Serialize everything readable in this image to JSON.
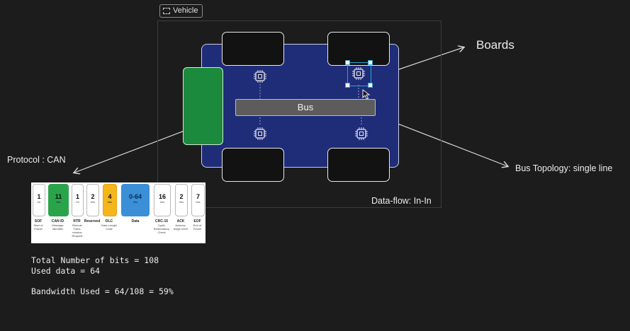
{
  "frame": {
    "label": "Vehicle"
  },
  "vehicle": {
    "bus_label": "Bus"
  },
  "annotations": {
    "boards": "Boards",
    "protocol": "Protocol : CAN",
    "bus_topology": "Bus Topology: single line",
    "data_flow": "Data-flow: In-In"
  },
  "can_frame": {
    "fields": [
      {
        "bits": "1",
        "unit": "bit",
        "name": "SOF",
        "desc": "Start of Frame",
        "color": "#ffffff"
      },
      {
        "bits": "11",
        "unit": "bits",
        "name": "CAN ID",
        "desc": "Message Identifier",
        "color": "#2aa44a"
      },
      {
        "bits": "1",
        "unit": "bit",
        "name": "RTR",
        "desc": "Remote Trans-mission Request",
        "color": "#ffffff"
      },
      {
        "bits": "2",
        "unit": "bits",
        "name": "Reserved",
        "desc": "",
        "color": "#ffffff"
      },
      {
        "bits": "4",
        "unit": "bits",
        "name": "DLC",
        "desc": "Data Length Code",
        "color": "#f5b51c"
      },
      {
        "bits": "0-64",
        "unit": "bits",
        "name": "Data",
        "desc": "",
        "color": "#3a8fd7"
      },
      {
        "bits": "16",
        "unit": "bits",
        "name": "CRC-15",
        "desc": "Cyclic Redundancy Check",
        "color": "#ffffff"
      },
      {
        "bits": "2",
        "unit": "bits",
        "name": "ACK",
        "desc": "Acknow-ledge-ment",
        "color": "#ffffff"
      },
      {
        "bits": "7",
        "unit": "bits",
        "name": "EOF",
        "desc": "End of Frame",
        "color": "#ffffff"
      }
    ]
  },
  "stats": {
    "total": "Total Number of bits = 108",
    "used": "Used data = 64",
    "bandwidth": "Bandwidth Used = 64/108 = 59%"
  }
}
